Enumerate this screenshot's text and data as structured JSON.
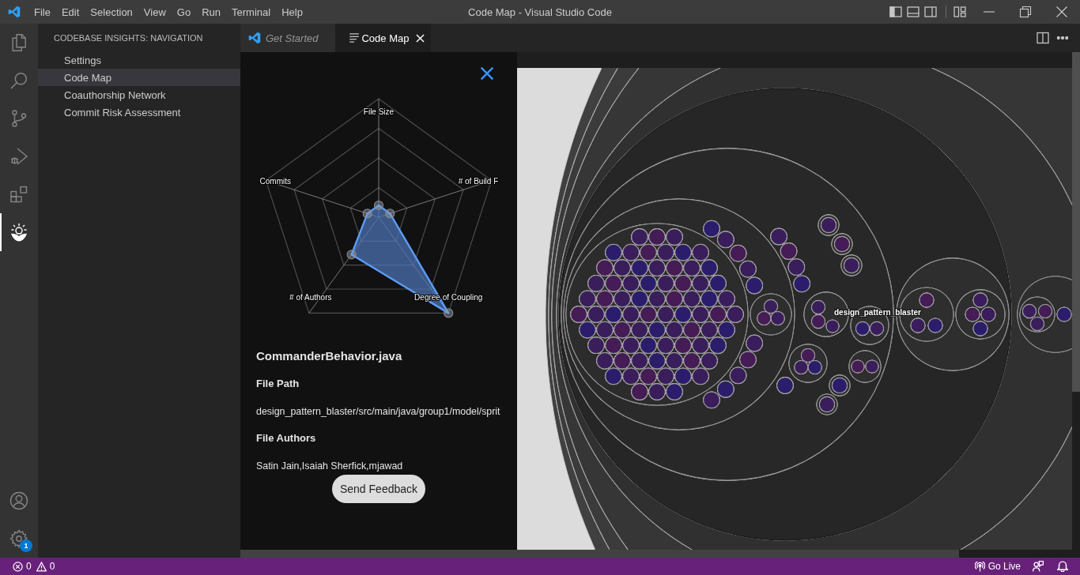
{
  "window": {
    "title": "Code Map - Visual Studio Code",
    "menu": [
      "File",
      "Edit",
      "Selection",
      "View",
      "Go",
      "Run",
      "Terminal",
      "Help"
    ]
  },
  "activity_bar": {
    "items": [
      {
        "kind": "explorer",
        "selected": false
      },
      {
        "kind": "search",
        "selected": false
      },
      {
        "kind": "source_control",
        "selected": false
      },
      {
        "kind": "run_debug",
        "selected": false
      },
      {
        "kind": "extensions",
        "selected": false
      },
      {
        "kind": "insights",
        "selected": true
      }
    ],
    "settings_badge": "1"
  },
  "sidebar": {
    "title": "CODEBASE INSIGHTS: NAVIGATION",
    "items": [
      {
        "label": "Settings",
        "selected": false
      },
      {
        "label": "Code Map",
        "selected": true
      },
      {
        "label": "Coauthorship Network",
        "selected": false
      },
      {
        "label": "Commit Risk Assessment",
        "selected": false
      }
    ]
  },
  "tabs": [
    {
      "label": "Get Started",
      "kind": "welcome",
      "preview": true,
      "selected": false
    },
    {
      "label": "Code Map",
      "kind": "webview",
      "preview": false,
      "selected": true
    }
  ],
  "details": {
    "radar_axes": [
      "File Size",
      "Commits",
      "# of Build F",
      "# of Authors",
      "Degree of Coupling"
    ],
    "file_name": "CommanderBehavior.java",
    "fields": [
      {
        "heading": "File Path",
        "value": "design_pattern_blaster/src/main/java/group1/model/sprit"
      },
      {
        "heading": "File Authors",
        "value": "Satin Jain,Isaiah Sherfick,mjawad"
      }
    ],
    "feedback_button": "Send Feedback"
  },
  "code_map": {
    "label": "design_pattern_blaster"
  },
  "status_bar": {
    "errors": "0",
    "warnings": "0",
    "go_live": "Go Live"
  }
}
